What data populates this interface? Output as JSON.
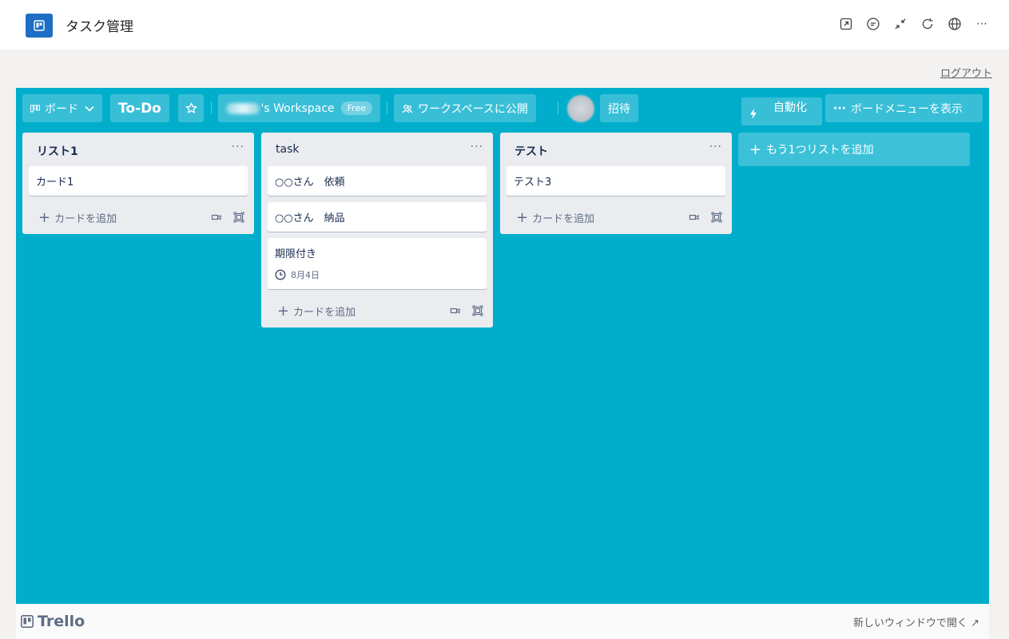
{
  "app": {
    "title": "タスク管理",
    "logout": "ログアウト"
  },
  "appbar_icons": [
    "popout-icon",
    "chat-icon",
    "collapse-icon",
    "refresh-icon",
    "globe-icon",
    "more-icon"
  ],
  "board": {
    "view_label": "ボード",
    "title": "To-Do",
    "workspace": "'s Workspace",
    "plan_badge": "Free",
    "visibility": "ワークスペースに公開",
    "invite": "招待",
    "automation": "自動化",
    "menu": "ボードメニューを表示",
    "colors": {
      "background": "#00aecc"
    }
  },
  "lists": [
    {
      "title": "リスト1",
      "cards": [
        {
          "text": "カード1"
        }
      ],
      "add_card": "カードを追加"
    },
    {
      "title": "task",
      "cards": [
        {
          "text": "○○さん　依頼"
        },
        {
          "text": "○○さん　納品"
        },
        {
          "text": "期限付き",
          "due": "8月4日"
        }
      ],
      "add_card": "カードを追加"
    },
    {
      "title": "テスト",
      "cards": [
        {
          "text": "テスト3"
        }
      ],
      "add_card": "カードを追加"
    }
  ],
  "add_list": "もう1つリストを追加",
  "footer": {
    "brand": "Trello",
    "open_new_window": "新しいウィンドウで開く ↗"
  }
}
